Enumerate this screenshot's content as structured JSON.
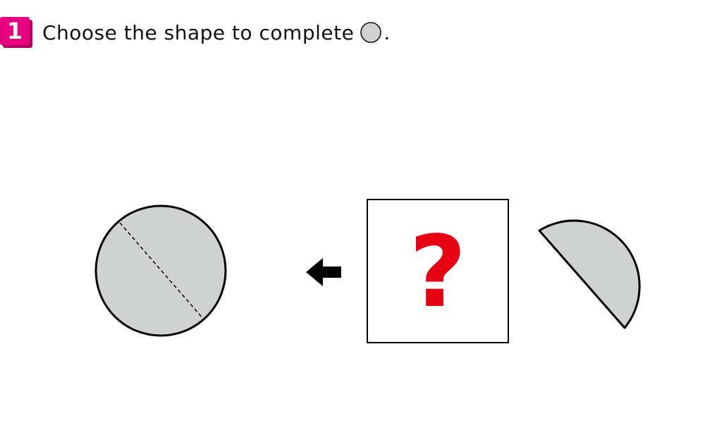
{
  "badge": {
    "number": "1",
    "color": "#e6007e"
  },
  "instruction": {
    "text": "Choose the shape to complete",
    "punctuation": "."
  },
  "puzzle": {
    "question_mark": "?",
    "question_mark_color": "#e60012",
    "shape_fill": "#d0d2d1",
    "arrow_direction": "left"
  }
}
